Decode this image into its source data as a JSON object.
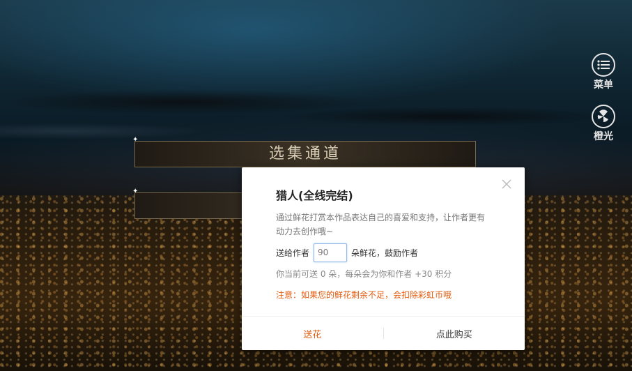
{
  "episode_selector": {
    "title": "选集通道"
  },
  "side_menu": {
    "menu_label": "菜单",
    "light_label": "橙光"
  },
  "dialog": {
    "title": "猎人(全线完结)",
    "description": "通过鲜花打赏本作品表达自己的喜爱和支持，让作者更有动力去创作哦~",
    "give_prefix": "送给作者",
    "input_placeholder": "90",
    "input_value": "",
    "give_suffix": "朵鲜花，鼓励作者",
    "balance_text": "你当前可送 0 朵，每朵会为你和作者 +30 积分",
    "notice_text": "注意：如果您的鲜花剩余不足，会扣除彩虹币哦",
    "send_label": "送花",
    "buy_label": "点此购买"
  },
  "colors": {
    "accent": "#e35b0e",
    "input_border": "#8fb8e8"
  }
}
